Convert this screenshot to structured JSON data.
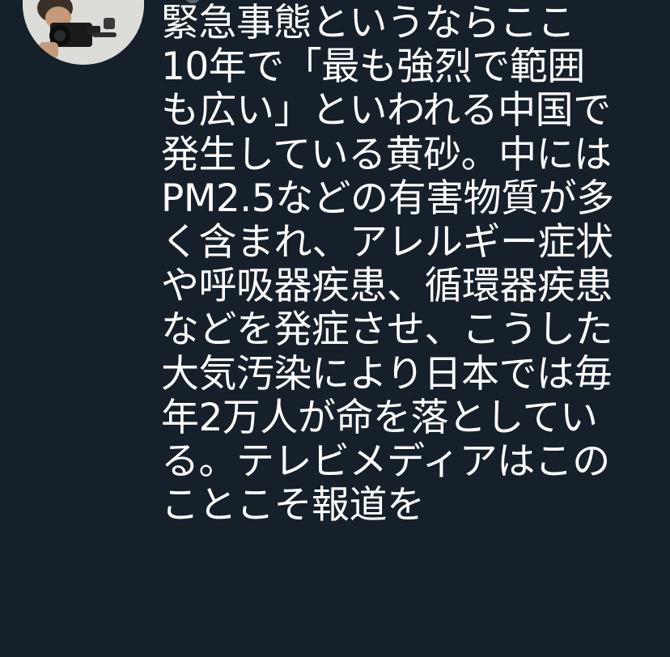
{
  "tweet": {
    "avatar": {
      "icon": "profile-photo-icon",
      "description_colors": {
        "background": "#dcdcd8",
        "camera": "#1a1a1a"
      }
    },
    "lines": [
      "緊急事態というならここ",
      "10年で「最も強烈で範囲",
      "も広い」といわれる中国で",
      "発生している黄砂。中には",
      "PM2.5などの有害物質が多",
      "く含まれ、アレルギー症状",
      "や呼吸器疾患、循環器疾患",
      "などを発症させ、こうした",
      "大気汚染により日本では毎",
      "年2万人が命を落としてい",
      "る。テレビメディアはこの",
      "ことこそ報道を"
    ]
  },
  "theme": {
    "background": "#15202b",
    "text": "#ffffff"
  }
}
